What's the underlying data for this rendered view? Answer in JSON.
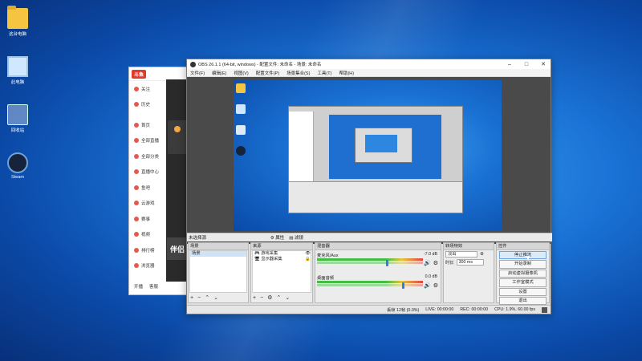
{
  "desktop": {
    "icons": [
      {
        "label": "这台电脑",
        "icon": "folder-user-icon"
      },
      {
        "label": "此电脑",
        "icon": "computer-icon"
      },
      {
        "label": "回收站",
        "icon": "recycle-bin-icon"
      },
      {
        "label": "Steam",
        "icon": "steam-icon"
      }
    ]
  },
  "browser_app": {
    "logo": "斗鱼",
    "top_items": [
      "关注",
      "历史"
    ],
    "nav": [
      "首页",
      "全部直播",
      "全部分类",
      "直播中心",
      "鱼吧",
      "云游戏",
      "赛事",
      "视频",
      "排行榜",
      "浏览器"
    ],
    "footer": [
      "开播",
      "客服"
    ],
    "banner": "伴侣"
  },
  "obs": {
    "title": "OBS 26.1.1 (64-bit, windows) - 配置文件: 未命名 - 场景: 未命名",
    "menu": [
      "文件(F)",
      "编辑(E)",
      "视图(V)",
      "配置文件(P)",
      "场景集合(S)",
      "工具(T)",
      "帮助(H)"
    ],
    "selection_bar": {
      "label": "未选择源",
      "props": "属性",
      "filters": "滤镜"
    },
    "scenes": {
      "title": "场景",
      "items": [
        "场景"
      ]
    },
    "sources": {
      "title": "来源",
      "items": [
        "游戏采集",
        "显示器采集"
      ]
    },
    "mixer": {
      "title": "混音器",
      "tracks": [
        {
          "name": "麦克风/Aux",
          "db": "-7.0 dB"
        },
        {
          "name": "桌面音频",
          "db": "0.0 dB"
        }
      ]
    },
    "transitions": {
      "title": "转场特效",
      "type": "淡出",
      "duration_label": "时长",
      "duration": "300 ms"
    },
    "controls": {
      "title": "控件",
      "buttons": [
        "停止推流",
        "开始录制",
        "启动虚拟摄像机",
        "工作室模式",
        "设置",
        "退出"
      ]
    },
    "status": {
      "dropped": "丢帧 12帧 (0.0%)",
      "live": "LIVE: 00:00:00",
      "rec": "REC: 00:00:00",
      "cpu": "CPU: 1.9%, 60.00 fps"
    }
  },
  "colors": {
    "accent": "#e23b2e",
    "obs_highlight": "#dbeaf9",
    "desktop": "#1a73d6"
  }
}
